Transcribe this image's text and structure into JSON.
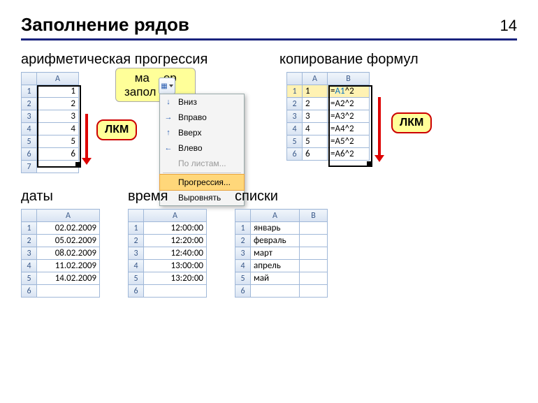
{
  "page": {
    "title": "Заполнение рядов",
    "number": "14"
  },
  "sections": {
    "arith": "арифметическая прогрессия",
    "formulas": "копирование формул",
    "dates": "даты",
    "time": "время",
    "lists": "списки"
  },
  "callouts": {
    "marker": "маркер\nзаполнения",
    "lkm": "ЛКМ"
  },
  "fill_menu": {
    "down": "Вниз",
    "right": "Вправо",
    "up": "Вверх",
    "left": "Влево",
    "sheets": "По листам...",
    "progression": "Прогрессия...",
    "justify": "Выровнять"
  },
  "grids": {
    "arith": {
      "header": "A",
      "rows": [
        "1",
        "2",
        "3",
        "4",
        "5",
        "6",
        ""
      ]
    },
    "formulas": {
      "headers": [
        "A",
        "B"
      ],
      "rows": [
        {
          "a": "1",
          "b_pre": "=",
          "b_ref": "A1",
          "b_post": "^2"
        },
        {
          "a": "2",
          "b": "=A2^2"
        },
        {
          "a": "3",
          "b": "=A3^2"
        },
        {
          "a": "4",
          "b": "=A4^2"
        },
        {
          "a": "5",
          "b": "=A5^2"
        },
        {
          "a": "6",
          "b": "=A6^2"
        }
      ]
    },
    "dates": {
      "header": "A",
      "rows": [
        "02.02.2009",
        "05.02.2009",
        "08.02.2009",
        "11.02.2009",
        "14.02.2009",
        ""
      ]
    },
    "time": {
      "header": "A",
      "rows": [
        "12:00:00",
        "12:20:00",
        "12:40:00",
        "13:00:00",
        "13:20:00",
        ""
      ]
    },
    "lists": {
      "headers": [
        "A",
        "B"
      ],
      "rows": [
        "январь",
        "февраль",
        "март",
        "апрель",
        "май",
        ""
      ]
    }
  }
}
